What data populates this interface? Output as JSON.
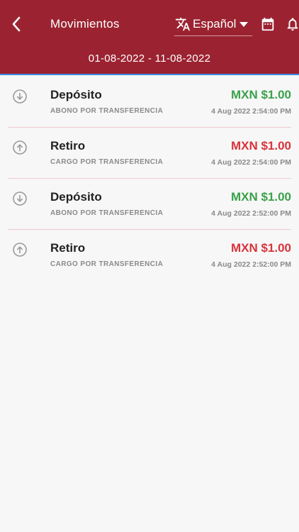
{
  "header": {
    "title": "Movimientos",
    "language": "Español",
    "date_range": "01-08-2022 - 11-08-2022",
    "icons": {
      "back": "back-chevron-icon",
      "translate": "translate-icon",
      "caret": "caret-down-icon",
      "calendar": "calendar-icon",
      "bell": "bell-icon"
    }
  },
  "colors": {
    "header_bg": "#9b2331",
    "deposit_green": "#3aa14a",
    "withdraw_red": "#d9343b"
  },
  "movements": [
    {
      "title": "Depósito",
      "subtitle": "ABONO POR TRANSFERENCIA",
      "amount": "MXN $1.00",
      "date": "4 Aug 2022 2:54:00 PM",
      "type": "deposit"
    },
    {
      "title": "Retiro",
      "subtitle": "CARGO POR TRANSFERENCIA",
      "amount": "MXN $1.00",
      "date": "4 Aug 2022 2:54:00 PM",
      "type": "withdrawal"
    },
    {
      "title": "Depósito",
      "subtitle": "ABONO POR TRANSFERENCIA",
      "amount": "MXN $1.00",
      "date": "4 Aug 2022 2:52:00 PM",
      "type": "deposit"
    },
    {
      "title": "Retiro",
      "subtitle": "CARGO POR TRANSFERENCIA",
      "amount": "MXN $1.00",
      "date": "4 Aug 2022 2:52:00 PM",
      "type": "withdrawal"
    }
  ]
}
